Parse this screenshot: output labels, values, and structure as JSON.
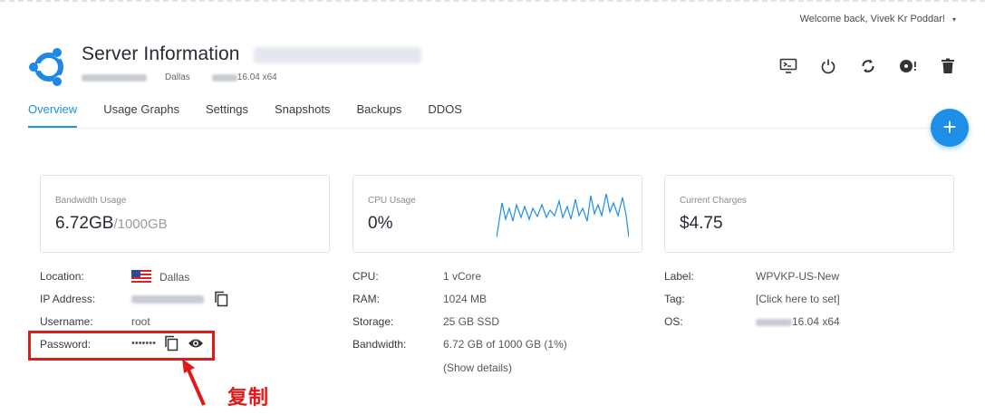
{
  "header": {
    "welcome": "Welcome back, Vivek Kr Poddar!",
    "title": "Server Information",
    "subtitle_city": "Dallas",
    "subtitle_os": "16.04 x64"
  },
  "actions": [
    "console-icon",
    "power-icon",
    "restart-icon",
    "reinstall-icon",
    "trash-icon"
  ],
  "tabs": [
    {
      "label": "Overview",
      "active": true
    },
    {
      "label": "Usage Graphs"
    },
    {
      "label": "Settings"
    },
    {
      "label": "Snapshots"
    },
    {
      "label": "Backups"
    },
    {
      "label": "DDOS"
    }
  ],
  "cards": {
    "bandwidth": {
      "label": "Bandwidth Usage",
      "value": "6.72GB",
      "max": "/1000GB"
    },
    "cpu": {
      "label": "CPU Usage",
      "value": "0%"
    },
    "charges": {
      "label": "Current Charges",
      "value": "$4.75"
    }
  },
  "details_left": {
    "location_label": "Location:",
    "location_value": "Dallas",
    "ip_label": "IP Address:",
    "username_label": "Username:",
    "username_value": "root",
    "password_label": "Password:",
    "password_value": "•••••••"
  },
  "details_mid": {
    "cpu_label": "CPU:",
    "cpu_value": "1 vCore",
    "ram_label": "RAM:",
    "ram_value": "1024 MB",
    "storage_label": "Storage:",
    "storage_value": "25 GB SSD",
    "bw_label": "Bandwidth:",
    "bw_value": "6.72 GB of 1000 GB (1%)",
    "show_details": "(Show details)"
  },
  "details_right": {
    "label_label": "Label:",
    "label_value": "WPVKP-US-New",
    "tag_label": "Tag:",
    "tag_value": "[Click here to set]",
    "os_label": "OS:",
    "os_value": "16.04 x64"
  },
  "annotation": {
    "text": "复制",
    "color": "#e01919"
  },
  "colors": {
    "accent": "#1f8ee6",
    "logo": "#1e88e5",
    "annotation": "#e01919"
  }
}
